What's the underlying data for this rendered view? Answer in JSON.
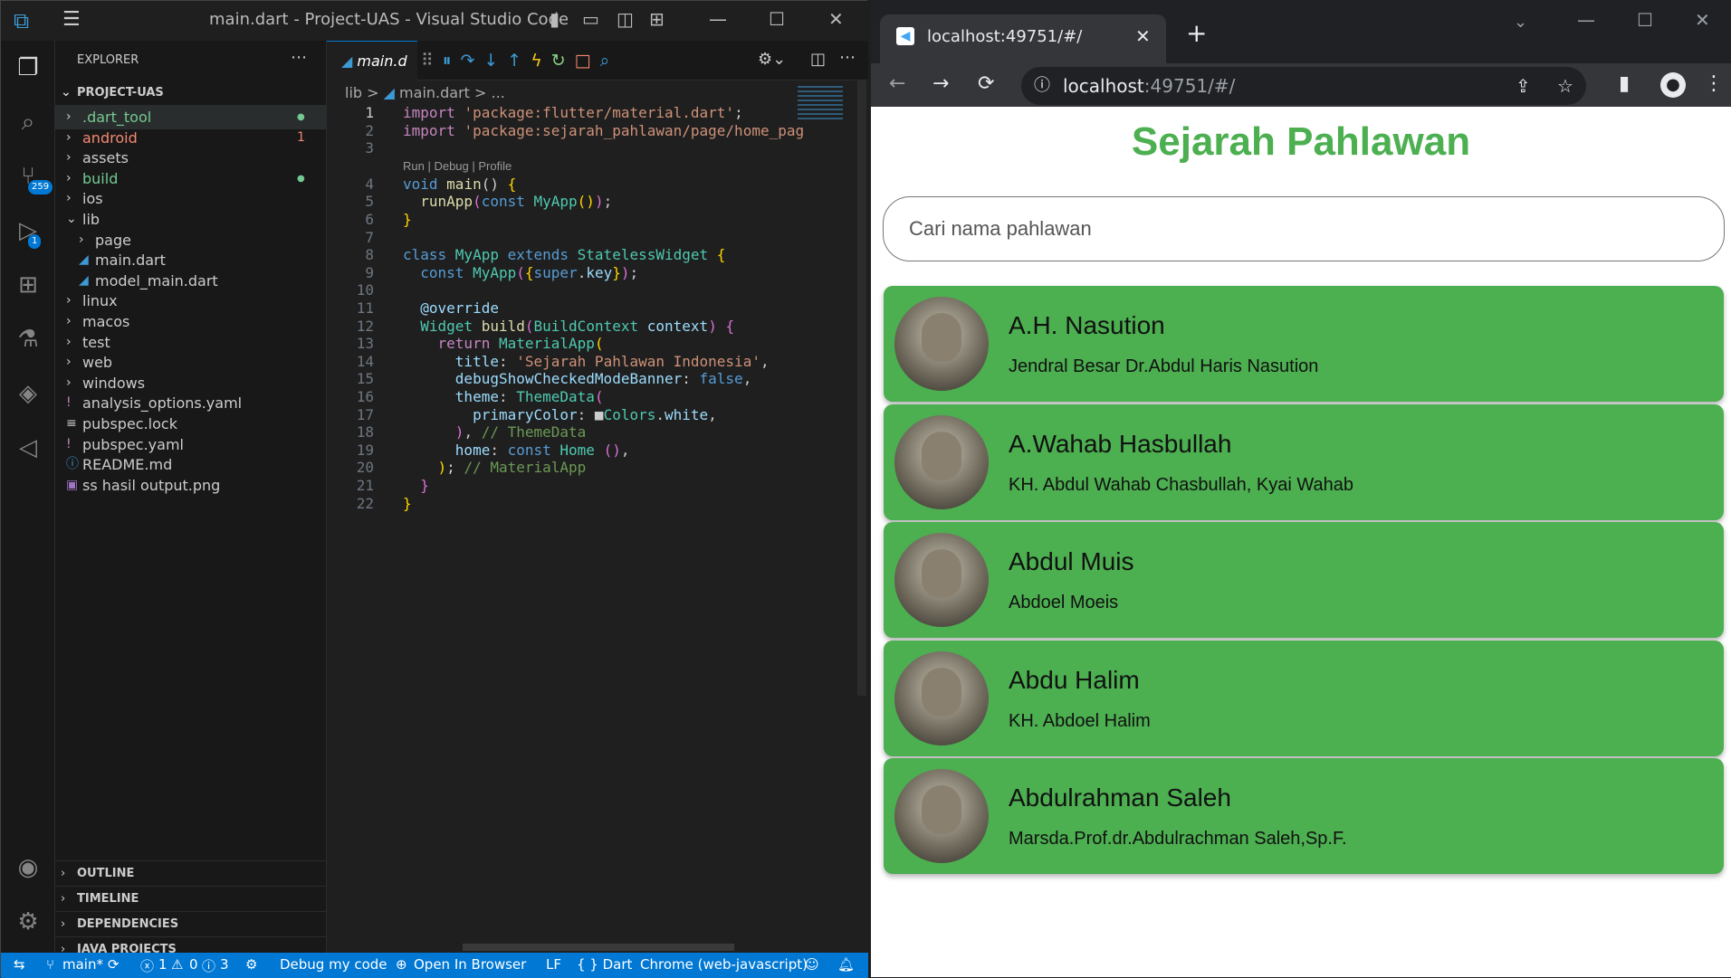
{
  "vscode": {
    "title": "main.dart - Project-UAS - Visual Studio Code",
    "explorer_label": "EXPLORER",
    "project": "PROJECT-UAS",
    "tree": [
      {
        "name": ".dart_tool",
        "type": "folder",
        "depth": 0,
        "status": "dot",
        "color": "#73c991"
      },
      {
        "name": "android",
        "type": "folder",
        "depth": 0,
        "status": "1",
        "color": "#f48771"
      },
      {
        "name": "assets",
        "type": "folder",
        "depth": 0,
        "status": "",
        "color": "#cccccc"
      },
      {
        "name": "build",
        "type": "folder",
        "depth": 0,
        "status": "dot",
        "color": "#73c991"
      },
      {
        "name": "ios",
        "type": "folder",
        "depth": 0,
        "status": "",
        "color": "#cccccc"
      },
      {
        "name": "lib",
        "type": "folder-open",
        "depth": 0,
        "status": "",
        "color": "#cccccc"
      },
      {
        "name": "page",
        "type": "folder",
        "depth": 1,
        "status": "",
        "color": "#cccccc"
      },
      {
        "name": "main.dart",
        "type": "dart",
        "depth": 1,
        "status": "",
        "color": "#cccccc"
      },
      {
        "name": "model_main.dart",
        "type": "dart",
        "depth": 1,
        "status": "",
        "color": "#cccccc"
      },
      {
        "name": "linux",
        "type": "folder",
        "depth": 0,
        "status": "",
        "color": "#cccccc"
      },
      {
        "name": "macos",
        "type": "folder",
        "depth": 0,
        "status": "",
        "color": "#cccccc"
      },
      {
        "name": "test",
        "type": "folder",
        "depth": 0,
        "status": "",
        "color": "#cccccc"
      },
      {
        "name": "web",
        "type": "folder",
        "depth": 0,
        "status": "",
        "color": "#cccccc"
      },
      {
        "name": "windows",
        "type": "folder",
        "depth": 0,
        "status": "",
        "color": "#cccccc"
      },
      {
        "name": "analysis_options.yaml",
        "type": "yaml",
        "depth": 0,
        "status": "",
        "color": "#cccccc"
      },
      {
        "name": "pubspec.lock",
        "type": "lock",
        "depth": 0,
        "status": "",
        "color": "#cccccc"
      },
      {
        "name": "pubspec.yaml",
        "type": "yaml",
        "depth": 0,
        "status": "",
        "color": "#cccccc"
      },
      {
        "name": "README.md",
        "type": "info",
        "depth": 0,
        "status": "",
        "color": "#cccccc"
      },
      {
        "name": "ss hasil output.png",
        "type": "image",
        "depth": 0,
        "status": "",
        "color": "#cccccc"
      }
    ],
    "sections": [
      "OUTLINE",
      "TIMELINE",
      "DEPENDENCIES",
      "JAVA PROJECTS"
    ],
    "tab": "main.d",
    "breadcrumb": [
      "lib",
      ">",
      "main.dart",
      ">",
      "..."
    ],
    "codelens": "Run | Debug | Profile",
    "code": [
      [
        {
          "t": "import ",
          "c": "ctl"
        },
        {
          "t": "'package:flutter/material.dart'",
          "c": "st"
        },
        {
          "t": ";",
          "c": ""
        }
      ],
      [
        {
          "t": "import ",
          "c": "ctl"
        },
        {
          "t": "'package:sejarah_pahlawan/page/home_pag",
          "c": "st"
        }
      ],
      [],
      [
        {
          "t": "void ",
          "c": "kw"
        },
        {
          "t": "main",
          "c": "fn"
        },
        {
          "t": "() ",
          "c": ""
        },
        {
          "t": "{",
          "c": "br"
        }
      ],
      [
        {
          "t": "  runApp",
          "c": "fn"
        },
        {
          "t": "(",
          "c": "br2"
        },
        {
          "t": "const ",
          "c": "kw"
        },
        {
          "t": "MyApp",
          "c": "cls"
        },
        {
          "t": "()",
          "c": "br"
        },
        {
          "t": ")",
          "c": "br2"
        },
        {
          "t": ";",
          "c": ""
        }
      ],
      [
        {
          "t": "}",
          "c": "br"
        }
      ],
      [],
      [
        {
          "t": "class ",
          "c": "kw"
        },
        {
          "t": "MyApp ",
          "c": "cls"
        },
        {
          "t": "extends ",
          "c": "kw"
        },
        {
          "t": "StatelessWidget ",
          "c": "cls"
        },
        {
          "t": "{",
          "c": "br"
        }
      ],
      [
        {
          "t": "  const ",
          "c": "kw"
        },
        {
          "t": "MyApp",
          "c": "cls"
        },
        {
          "t": "(",
          "c": "br2"
        },
        {
          "t": "{",
          "c": "br"
        },
        {
          "t": "super",
          "c": "kw"
        },
        {
          "t": ".",
          "c": ""
        },
        {
          "t": "key",
          "c": "pr"
        },
        {
          "t": "}",
          "c": "br"
        },
        {
          "t": ")",
          "c": "br2"
        },
        {
          "t": ";",
          "c": ""
        }
      ],
      [],
      [
        {
          "t": "  @override",
          "c": "pr"
        }
      ],
      [
        {
          "t": "  Widget ",
          "c": "cls"
        },
        {
          "t": "build",
          "c": "fn"
        },
        {
          "t": "(",
          "c": "br2"
        },
        {
          "t": "BuildContext ",
          "c": "cls"
        },
        {
          "t": "context",
          "c": "pr"
        },
        {
          "t": ") ",
          "c": "br2"
        },
        {
          "t": "{",
          "c": "br2"
        }
      ],
      [
        {
          "t": "    return ",
          "c": "ctl"
        },
        {
          "t": "MaterialApp",
          "c": "cls"
        },
        {
          "t": "(",
          "c": "br"
        }
      ],
      [
        {
          "t": "      title",
          "c": "pr"
        },
        {
          "t": ": ",
          "c": ""
        },
        {
          "t": "'Sejarah Pahlawan Indonesia'",
          "c": "st"
        },
        {
          "t": ",",
          "c": ""
        }
      ],
      [
        {
          "t": "      debugShowCheckedModeBanner",
          "c": "pr"
        },
        {
          "t": ": ",
          "c": ""
        },
        {
          "t": "false",
          "c": "kw"
        },
        {
          "t": ",",
          "c": ""
        }
      ],
      [
        {
          "t": "      theme",
          "c": "pr"
        },
        {
          "t": ": ",
          "c": ""
        },
        {
          "t": "ThemeData",
          "c": "cls"
        },
        {
          "t": "(",
          "c": "br2"
        }
      ],
      [
        {
          "t": "        primaryColor",
          "c": "pr"
        },
        {
          "t": ": ",
          "c": ""
        },
        {
          "t": "■",
          "c": ""
        },
        {
          "t": "Colors",
          "c": "cls"
        },
        {
          "t": ".",
          "c": ""
        },
        {
          "t": "white",
          "c": "pr"
        },
        {
          "t": ",",
          "c": ""
        }
      ],
      [
        {
          "t": "      ",
          "c": ""
        },
        {
          "t": ")",
          "c": "br2"
        },
        {
          "t": ", ",
          "c": ""
        },
        {
          "t": "// ThemeData",
          "c": "cm"
        }
      ],
      [
        {
          "t": "      home",
          "c": "pr"
        },
        {
          "t": ": ",
          "c": ""
        },
        {
          "t": "const ",
          "c": "kw"
        },
        {
          "t": "Home ",
          "c": "cls"
        },
        {
          "t": "()",
          "c": "br2"
        },
        {
          "t": ",",
          "c": ""
        }
      ],
      [
        {
          "t": "    ",
          "c": ""
        },
        {
          "t": ")",
          "c": "br"
        },
        {
          "t": "; ",
          "c": ""
        },
        {
          "t": "// MaterialApp",
          "c": "cm"
        }
      ],
      [
        {
          "t": "  ",
          "c": ""
        },
        {
          "t": "}",
          "c": "br2"
        }
      ],
      [
        {
          "t": "}",
          "c": "br"
        }
      ]
    ],
    "status": {
      "branch": "main*",
      "errors": "1",
      "warnings": "0",
      "infos": "3",
      "debug": "Debug my code",
      "open": "Open In Browser",
      "eol": "LF",
      "lang": "{ } Dart",
      "device": "Chrome (web-javascript)"
    },
    "badges": {
      "scm": "259",
      "debug": "1"
    }
  },
  "chrome": {
    "tab_title": "localhost:49751/#/",
    "url_host": "localhost",
    "url_rest": ":49751/#/"
  },
  "app": {
    "title": "Sejarah Pahlawan",
    "search_placeholder": "Cari nama pahlawan",
    "heroes": [
      {
        "name": "A.H. Nasution",
        "full": "Jendral Besar Dr.Abdul Haris Nasution"
      },
      {
        "name": "A.Wahab Hasbullah",
        "full": "KH. Abdul Wahab Chasbullah, Kyai Wahab"
      },
      {
        "name": "Abdul Muis",
        "full": "Abdoel Moeis"
      },
      {
        "name": "Abdu Halim",
        "full": "KH. Abdoel Halim"
      },
      {
        "name": "Abdulrahman Saleh",
        "full": "Marsda.Prof.dr.Abdulrachman Saleh,Sp.F."
      }
    ],
    "accent": "#4caf50"
  }
}
